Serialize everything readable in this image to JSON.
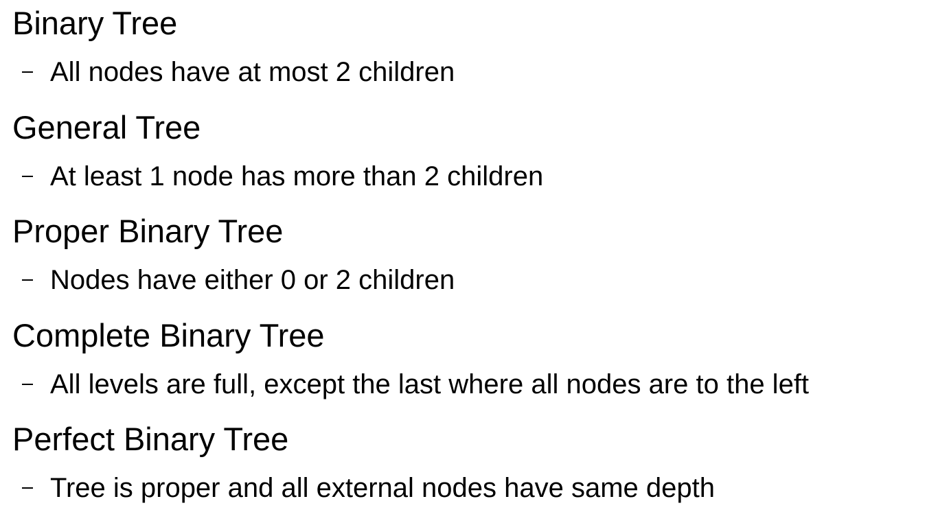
{
  "terms": [
    {
      "heading": "Binary Tree",
      "definition": "All nodes have at most 2 children"
    },
    {
      "heading": "General Tree",
      "definition": "At least 1 node has more than 2 children"
    },
    {
      "heading": "Proper Binary Tree",
      "definition": "Nodes have either 0 or 2 children"
    },
    {
      "heading": "Complete Binary Tree",
      "definition": "All levels are full, except the last where all nodes are to the left"
    },
    {
      "heading": "Perfect Binary Tree",
      "definition": "Tree is proper and all external nodes have same depth"
    }
  ]
}
